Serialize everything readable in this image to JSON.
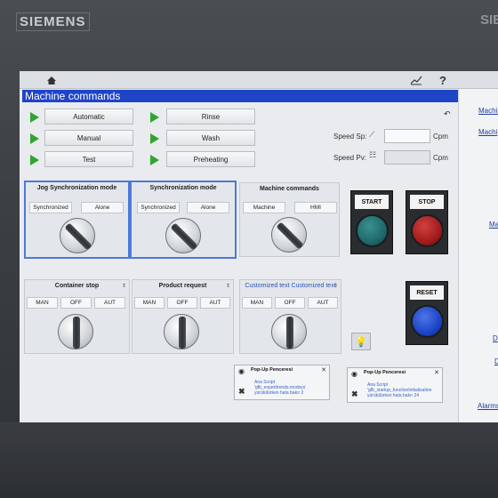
{
  "brand": "SIEMENS",
  "brand_right": "SIE",
  "topbar": {
    "home_icon": "home-icon",
    "trend_icon": "trend-icon",
    "help_label": "?"
  },
  "screen_title": "Machine commands",
  "commands_left": [
    {
      "label": "Automatic"
    },
    {
      "label": "Manual"
    },
    {
      "label": "Test"
    }
  ],
  "commands_right": [
    {
      "label": "Rinse"
    },
    {
      "label": "Wash"
    },
    {
      "label": "Preheating"
    }
  ],
  "speed": {
    "sp_label": "Speed Sp:",
    "pv_label": "Speed Pv:",
    "unit": "Cpm",
    "sp_value": "",
    "pv_value": ""
  },
  "modes": [
    {
      "title": "Jog Synchronization mode",
      "options": [
        "Synchronized",
        "Alone"
      ],
      "selected": true
    },
    {
      "title": "Synchronization mode",
      "options": [
        "Synchronized",
        "Alone"
      ],
      "selected": true
    },
    {
      "title": "Machine commands",
      "options": [
        "Machine",
        "HMI"
      ],
      "selected": false
    }
  ],
  "selectors": [
    {
      "title": "Container stop",
      "options": [
        "MAN",
        "OFF",
        "AUT"
      ]
    },
    {
      "title": "Product request",
      "options": [
        "MAN",
        "OFF",
        "AUT"
      ]
    },
    {
      "title": "Customized text Customized text",
      "options": [
        "MAN",
        "OFF",
        "AUT"
      ]
    }
  ],
  "hw_buttons": [
    {
      "label": "START",
      "color": "#1f6a6a"
    },
    {
      "label": "STOP",
      "color": "#a21c1c"
    },
    {
      "label": "RESET",
      "color": "#1c45c9"
    }
  ],
  "popups": [
    {
      "title": "Pop-Up Penceresi",
      "lines": [
        "Ana Script",
        "'gfb_exporttrends.modsys'",
        "yürütülürken hata bakır 2"
      ]
    },
    {
      "title": "Pop-Up Penceresi",
      "lines": [
        "Ana Script",
        "'gfb_startup_functionInitialization",
        "yürütülürken hata bakır 24"
      ]
    }
  ],
  "right_panel": {
    "links": [
      "Machine",
      "Machi",
      "Ma",
      "D",
      "D",
      "Alarms"
    ]
  }
}
